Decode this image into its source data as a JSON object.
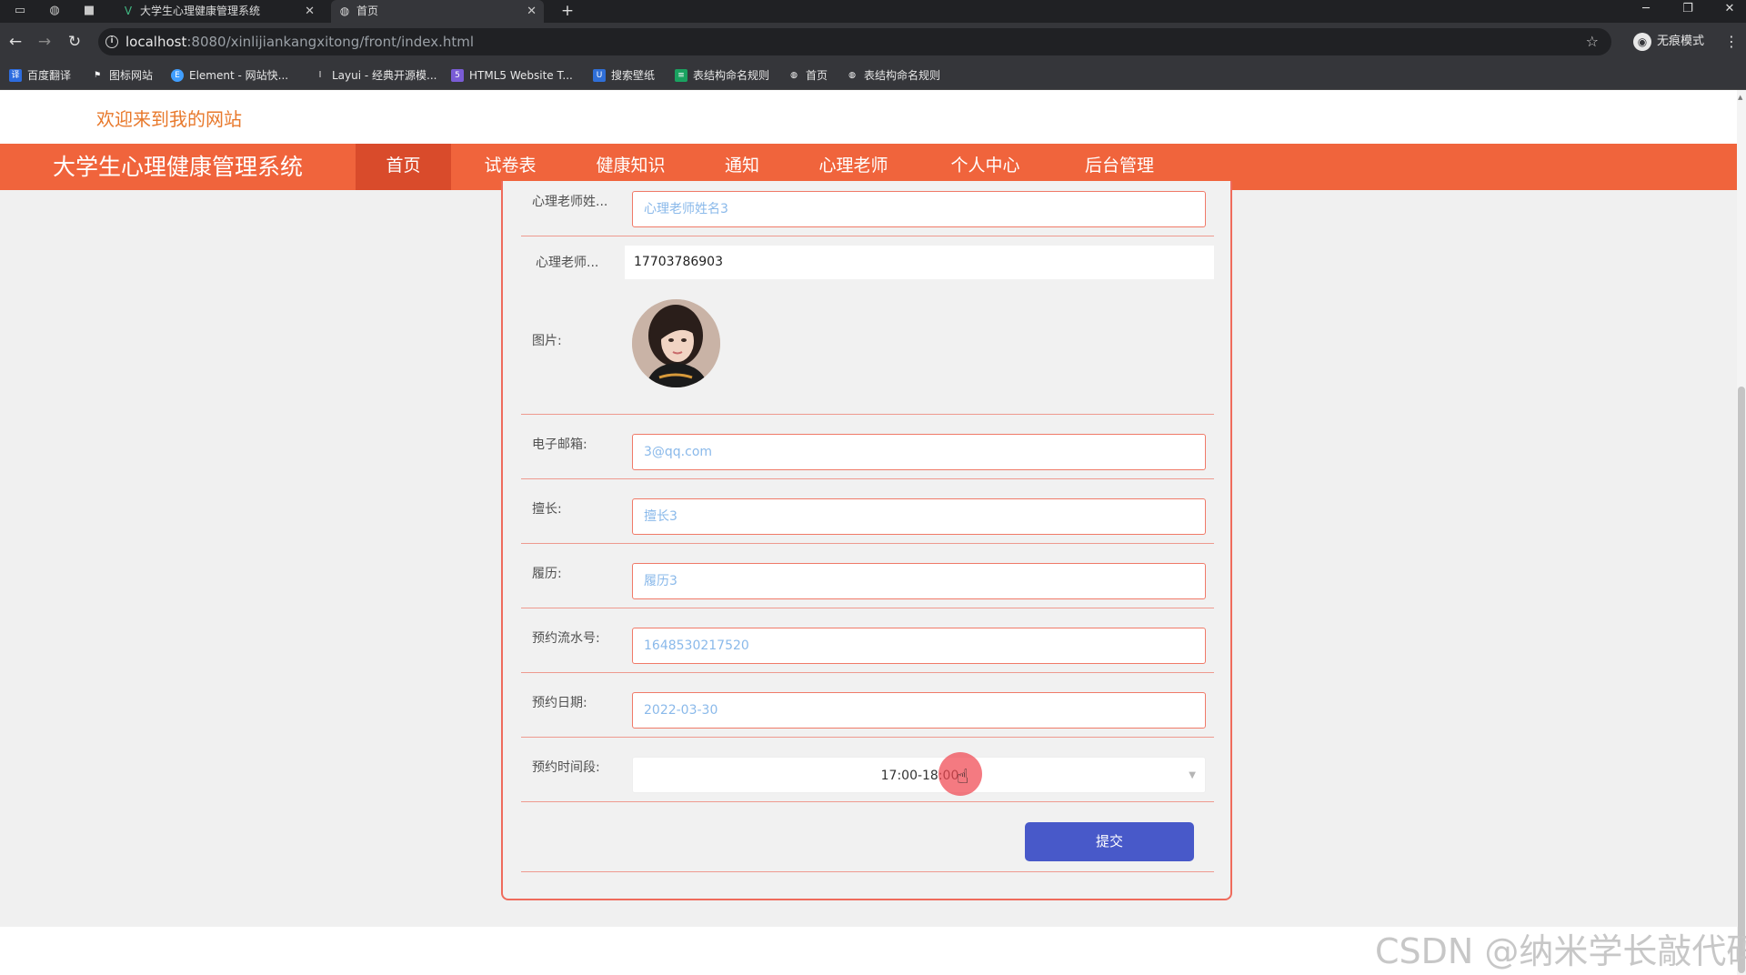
{
  "browser": {
    "tabs": [
      {
        "title": "大学生心理健康管理系统",
        "active": false,
        "icon": "vue-logo-icon"
      },
      {
        "title": "首页",
        "active": true,
        "icon": "globe-icon"
      }
    ],
    "url_host": "localhost",
    "url_path": ":8080/xinlijiankangxitong/front/index.html",
    "profile_label": "无痕模式",
    "bookmarks": [
      {
        "label": "百度翻译",
        "icon": "translate-icon",
        "color": "#2d6cdf"
      },
      {
        "label": "图标网站",
        "icon": "flag-icon",
        "color": "#444444"
      },
      {
        "label": "Element - 网站快...",
        "icon": "element-icon",
        "color": "#409eff"
      },
      {
        "label": "Layui - 经典开源模...",
        "icon": "layui-icon",
        "color": "#555555"
      },
      {
        "label": "HTML5 Website T...",
        "icon": "html5-icon",
        "color": "#7a5cd6"
      },
      {
        "label": "搜索壁纸",
        "icon": "wallpaper-icon",
        "color": "#2f6fd8"
      },
      {
        "label": "表结构命名规则",
        "icon": "sheet-icon",
        "color": "#1aa260"
      },
      {
        "label": "首页",
        "icon": "globe-icon",
        "color": "#555555"
      },
      {
        "label": "表结构命名规则",
        "icon": "globe-icon",
        "color": "#555555"
      }
    ]
  },
  "site": {
    "welcome": "欢迎来到我的网站",
    "title": "大学生心理健康管理系统",
    "nav": [
      "首页",
      "试卷表",
      "健康知识",
      "通知",
      "心理老师",
      "个人中心",
      "后台管理"
    ],
    "active_nav": "首页",
    "accent_color": "#f0643c"
  },
  "form": {
    "teacher_name_label": "心理老师姓...",
    "teacher_name_placeholder": "心理老师姓名3",
    "teacher_phone_label": "心理老师...",
    "teacher_phone_value": "17703786903",
    "image_label": "图片:",
    "email_label": "电子邮箱:",
    "email_placeholder": "3@qq.com",
    "specialty_label": "擅长:",
    "specialty_placeholder": "擅长3",
    "resume_label": "履历:",
    "resume_placeholder": "履历3",
    "serial_label": "预约流水号:",
    "serial_placeholder": "1648530217520",
    "date_label": "预约日期:",
    "date_placeholder": "2022-03-30",
    "timeslot_label": "预约时间段:",
    "timeslot_value": "17:00-18:00",
    "submit_label": "提交"
  },
  "watermark": "CSDN @纳米学长敲代码"
}
